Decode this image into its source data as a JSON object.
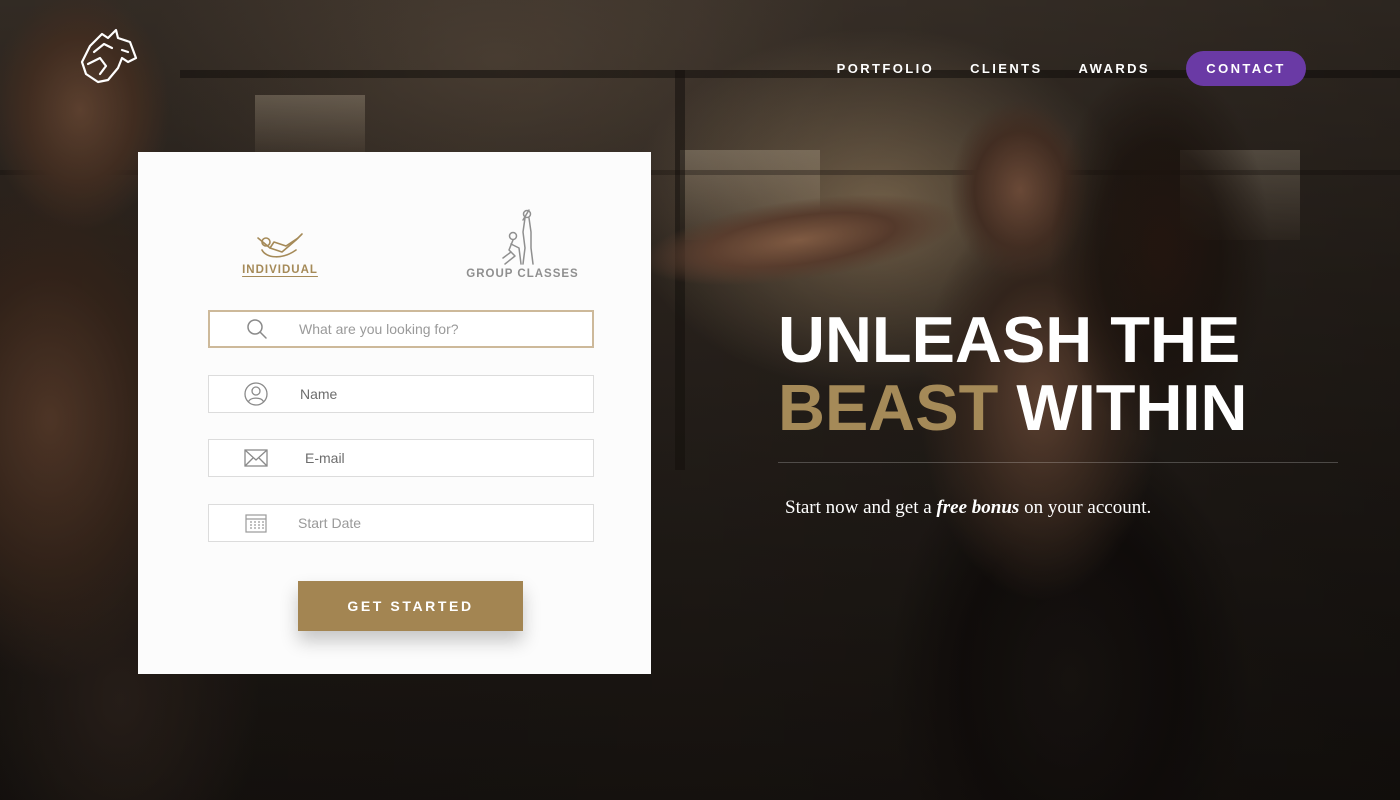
{
  "brand": {
    "logo_icon": "horse-head-icon"
  },
  "nav": {
    "items": [
      {
        "label": "PORTFOLIO"
      },
      {
        "label": "CLIENTS"
      },
      {
        "label": "AWARDS"
      }
    ],
    "contact_label": "CONTACT",
    "contact_color": "#6a3aa5"
  },
  "form": {
    "tabs": [
      {
        "label": "INDIVIDUAL",
        "icon": "situp-person-icon",
        "active": true
      },
      {
        "label": "GROUP CLASSES",
        "icon": "group-exercise-icon",
        "active": false
      }
    ],
    "search": {
      "placeholder": "What are you looking for?",
      "icon": "search-icon"
    },
    "name": {
      "placeholder": "Name",
      "icon": "user-icon"
    },
    "email": {
      "placeholder": "E-mail",
      "icon": "envelope-icon"
    },
    "start_date": {
      "placeholder": "Start Date",
      "icon": "calendar-icon"
    },
    "submit_label": "GET STARTED",
    "accent_color": "#a38552"
  },
  "hero": {
    "line1": "UNLEASH THE",
    "line2_accent": "BEAST",
    "line2_rest": "WITHIN",
    "sub_before": "Start now and get a",
    "sub_emphasis": "free bonus",
    "sub_after": "on your account."
  }
}
